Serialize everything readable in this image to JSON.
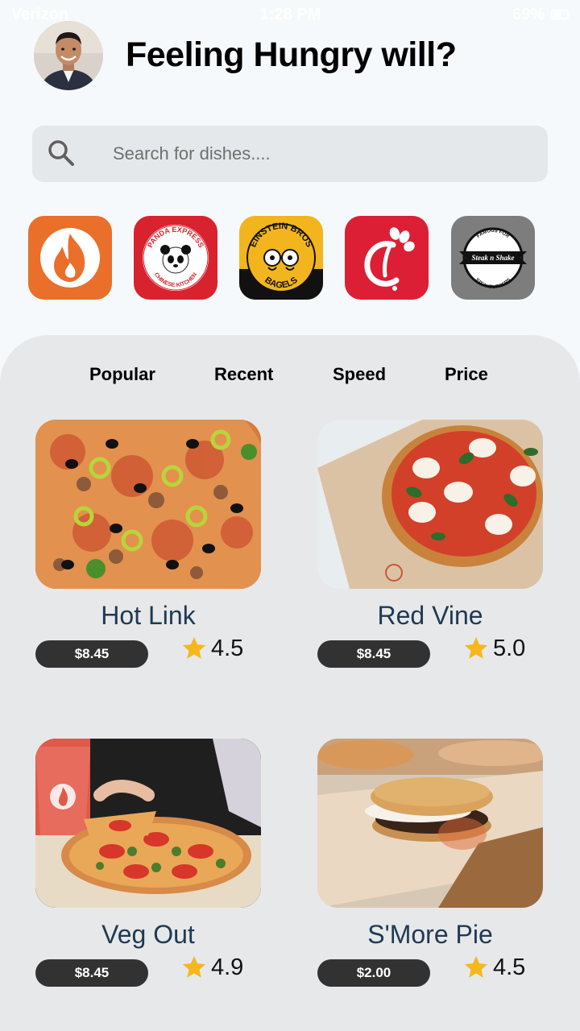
{
  "status_bar": {
    "carrier": "Verizon",
    "time": "1:28 PM",
    "battery": "69%"
  },
  "header": {
    "title": "Feeling Hungry will?"
  },
  "search": {
    "placeholder": "Search for dishes...."
  },
  "restaurants": [
    {
      "icon": "flame-logo-icon",
      "color": "#e96f2a"
    },
    {
      "icon": "panda-express-logo-icon",
      "color": "#d8232f",
      "text_top": "PANDA EXPRESS",
      "text_bottom": "CHINESE KITCHEN"
    },
    {
      "icon": "einstein-bros-logo-icon",
      "color": "#f2b51d",
      "text_top": "EINSTEIN BROS",
      "text_bottom": "BAGELS"
    },
    {
      "icon": "chick-fil-a-logo-icon",
      "color": "#dd1f35"
    },
    {
      "icon": "steak-n-shake-logo-icon",
      "color": "#7d7d7d",
      "text_top": "FAMOUS FOR",
      "text_bottom": "STEAKBURGERS",
      "text_mid": "Steak n Shake"
    }
  ],
  "tabs": [
    "Popular",
    "Recent",
    "Speed",
    "Price"
  ],
  "dishes": [
    {
      "name": "Hot Link",
      "price": "$8.45",
      "rating": "4.5"
    },
    {
      "name": "Red Vine",
      "price": "$8.45",
      "rating": "5.0"
    },
    {
      "name": "Veg Out",
      "price": "$8.45",
      "rating": "4.9"
    },
    {
      "name": "S'More Pie",
      "price": "$2.00",
      "rating": "4.5"
    }
  ],
  "colors": {
    "accent_dark": "#323232",
    "dish_name": "#1e3a52",
    "star": "#f5b81c",
    "panel": "#e7e8ea"
  }
}
